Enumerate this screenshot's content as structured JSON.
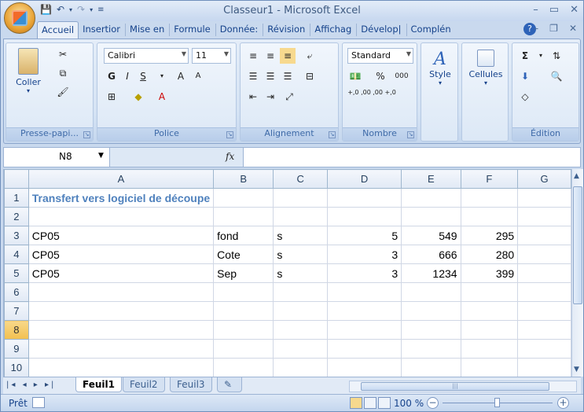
{
  "window": {
    "title": "Classeur1 - Microsoft Excel"
  },
  "qat": {
    "save_icon": "save-icon",
    "undo_icon": "undo-icon",
    "redo_icon": "redo-icon",
    "customize": "▼"
  },
  "tabs": [
    {
      "label": "Accueil",
      "active": true
    },
    {
      "label": "Insertior"
    },
    {
      "label": "Mise en"
    },
    {
      "label": "Formule"
    },
    {
      "label": "Donnée:"
    },
    {
      "label": "Révision"
    },
    {
      "label": "Affichag"
    },
    {
      "label": "Dévelop|"
    },
    {
      "label": "Complén"
    }
  ],
  "ribbon": {
    "clipboard": {
      "paste": "Coller",
      "group": "Presse-papi..."
    },
    "font": {
      "name": "Calibri",
      "size": "11",
      "bold": "G",
      "italic": "I",
      "underline": "S",
      "grow": "A",
      "shrink": "A",
      "group": "Police"
    },
    "alignment": {
      "group": "Alignement"
    },
    "number": {
      "format": "Standard",
      "percent": "%",
      "thousands": "000",
      "inc_dec": "+,0 ,00",
      "dec_dec": ",00 +,0",
      "group": "Nombre"
    },
    "style": {
      "label": "Style"
    },
    "cells": {
      "label": "Cellules"
    },
    "editing": {
      "sigma": "Σ",
      "group": "Édition"
    }
  },
  "formula_bar": {
    "name_box": "N8",
    "fx": "fx",
    "value": ""
  },
  "sheet": {
    "columns": [
      "A",
      "B",
      "C",
      "D",
      "E",
      "F",
      "G"
    ],
    "rows": [
      {
        "n": "1",
        "cells": [
          "Transfert vers logiciel de découpe",
          "",
          "",
          "",
          "",
          "",
          ""
        ]
      },
      {
        "n": "2",
        "cells": [
          "",
          "",
          "",
          "",
          "",
          "",
          ""
        ]
      },
      {
        "n": "3",
        "cells": [
          "CP05",
          "fond",
          "s",
          "5",
          "549",
          "295",
          ""
        ]
      },
      {
        "n": "4",
        "cells": [
          "CP05",
          "Cote",
          "s",
          "3",
          "666",
          "280",
          ""
        ]
      },
      {
        "n": "5",
        "cells": [
          "CP05",
          "Sep",
          "s",
          "3",
          "1234",
          "399",
          ""
        ]
      },
      {
        "n": "6",
        "cells": [
          "",
          "",
          "",
          "",
          "",
          "",
          ""
        ]
      },
      {
        "n": "7",
        "cells": [
          "",
          "",
          "",
          "",
          "",
          "",
          ""
        ]
      },
      {
        "n": "8",
        "cells": [
          "",
          "",
          "",
          "",
          "",
          "",
          ""
        ],
        "selected": true
      },
      {
        "n": "9",
        "cells": [
          "",
          "",
          "",
          "",
          "",
          "",
          ""
        ]
      },
      {
        "n": "10",
        "cells": [
          "",
          "",
          "",
          "",
          "",
          "",
          ""
        ]
      }
    ]
  },
  "sheet_tabs": [
    {
      "label": "Feuil1",
      "active": true
    },
    {
      "label": "Feuil2"
    },
    {
      "label": "Feuil3"
    }
  ],
  "status": {
    "ready": "Prêt",
    "zoom": "100 %",
    "minus": "−",
    "plus": "+",
    "zoom_level": 0.5
  },
  "colors": {
    "title_text": "#4f81bd",
    "selected_row_header": "#f2c050"
  }
}
